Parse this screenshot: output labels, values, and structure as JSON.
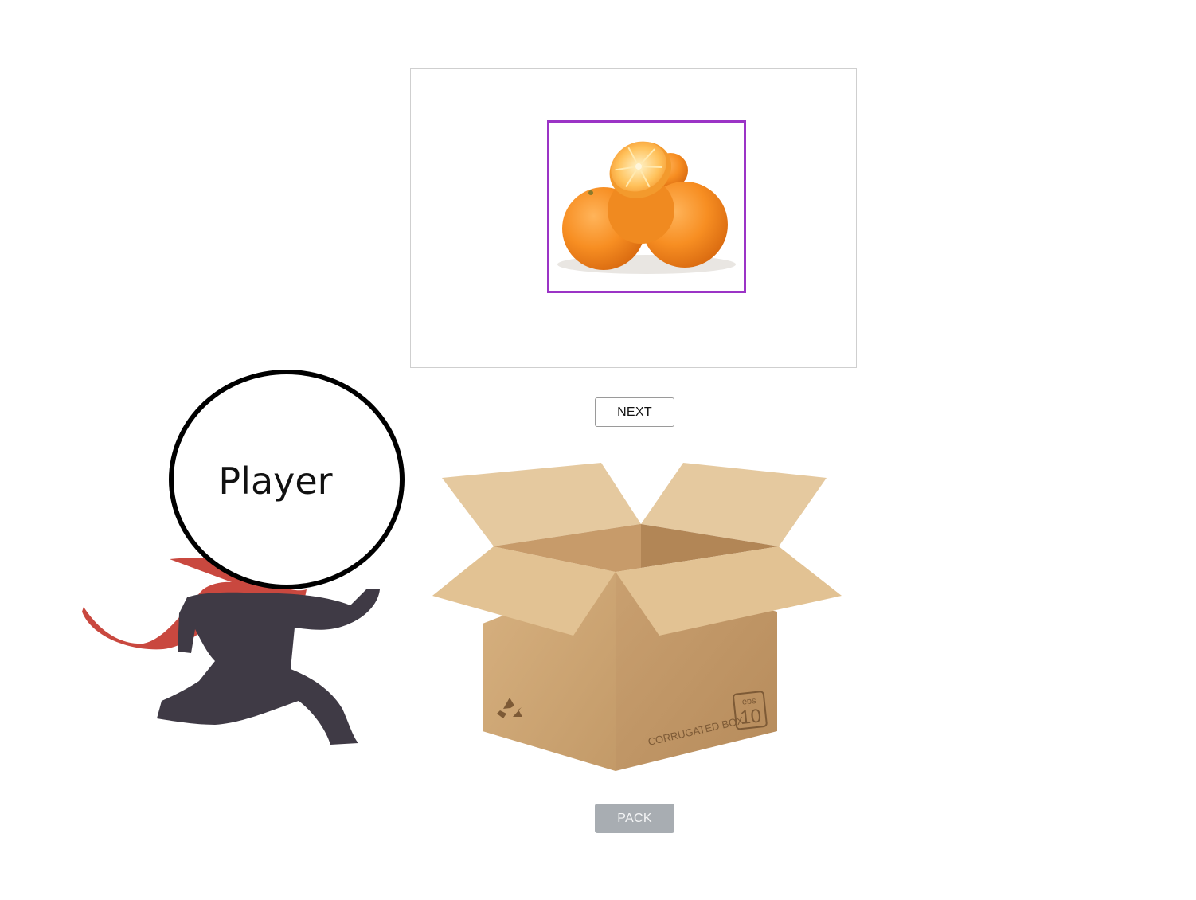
{
  "item": {
    "image_icon": "oranges-image",
    "frame_color": "#9b34c6"
  },
  "controls": {
    "next_label": "NEXT",
    "pack_label": "PACK",
    "pack_enabled": false
  },
  "player": {
    "label": "Player",
    "scarf_color": "#c9483f",
    "body_color": "#3f3a45"
  },
  "box": {
    "icon": "cardboard-box-icon",
    "side_text": "CORRUGATED BOX",
    "badge_top": "eps",
    "badge_number": "10",
    "recycle_icon": "recycle-icon"
  }
}
